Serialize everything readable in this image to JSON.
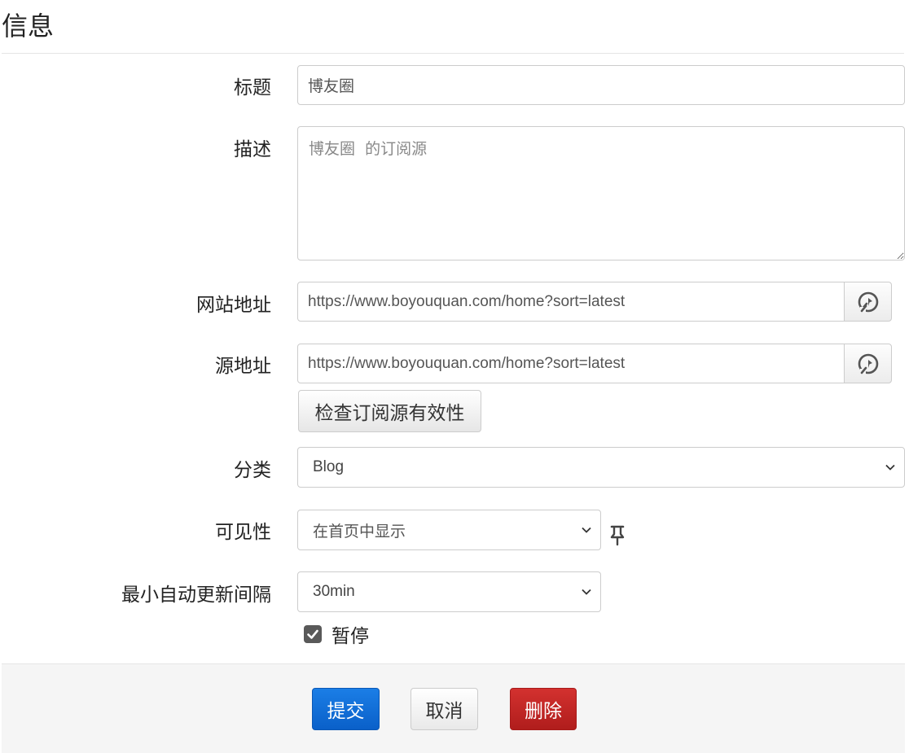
{
  "page": {
    "title": "信息"
  },
  "form": {
    "title": {
      "label": "标题",
      "value": "博友圈"
    },
    "description": {
      "label": "描述",
      "placeholder": "博友圈  的订阅源"
    },
    "website": {
      "label": "网站地址",
      "value": "https://www.boyouquan.com/home?sort=latest",
      "icon": "rocket-icon"
    },
    "source": {
      "label": "源地址",
      "value": "https://www.boyouquan.com/home?sort=latest",
      "icon": "rocket-icon"
    },
    "check_button": "检查订阅源有效性",
    "category": {
      "label": "分类",
      "value": "Blog"
    },
    "visibility": {
      "label": "可见性",
      "value": "在首页中显示",
      "icon": "pin-icon"
    },
    "interval": {
      "label": "最小自动更新间隔",
      "value": "30min"
    },
    "paused": {
      "label": "暂停",
      "checked": true
    }
  },
  "footer": {
    "submit": "提交",
    "cancel": "取消",
    "delete": "删除"
  },
  "colors": {
    "primary": "#0a60c9",
    "danger": "#b01d1c",
    "checkbox": "#595959"
  }
}
